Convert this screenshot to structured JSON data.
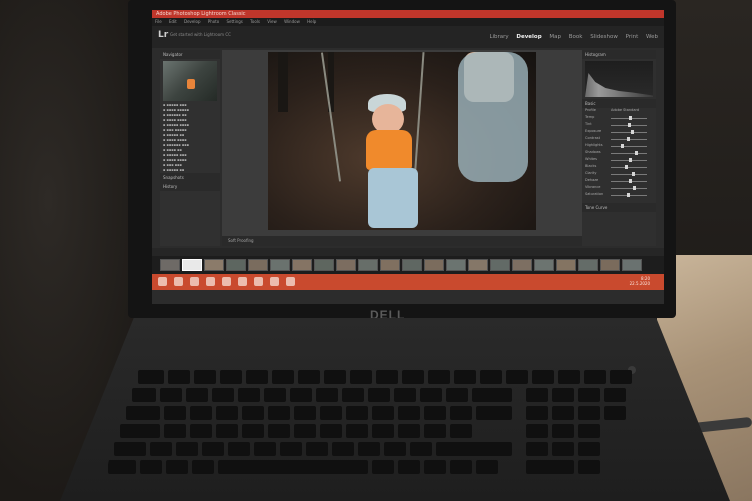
{
  "titlebar": {
    "text": "Adobe Photoshop Lightroom Classic"
  },
  "menubar": {
    "items": [
      "File",
      "Edit",
      "Develop",
      "Photo",
      "Settings",
      "Tools",
      "View",
      "Window",
      "Help"
    ]
  },
  "lr": {
    "logo": "Lr",
    "subtitle": "Get started with Lightroom CC",
    "modules": [
      "Library",
      "Develop",
      "Map",
      "Book",
      "Slideshow",
      "Print",
      "Web"
    ],
    "active_module": "Develop"
  },
  "left_panel": {
    "navigator_label": "Navigator",
    "snapshots_label": "Snapshots",
    "history_label": "History"
  },
  "right_panel": {
    "histogram_label": "Histogram",
    "basic_label": "Basic",
    "profile_label": "Profile",
    "profile_value": "Adobe Standard",
    "tone_curve_label": "Tone Curve",
    "sliders": [
      "Temp",
      "Tint",
      "Exposure",
      "Contrast",
      "Highlights",
      "Shadows",
      "Whites",
      "Blacks",
      "Clarity",
      "Dehaze",
      "Vibrance",
      "Saturation"
    ]
  },
  "toolbar": {
    "soft_proofing": "Soft Proofing"
  },
  "taskbar": {
    "time": "8:20",
    "date": "22.5.2020"
  },
  "brand": {
    "logo": "DELL"
  },
  "colors": {
    "taskbar": "#c94a2e",
    "titlebar": "#c0362b",
    "lr_bg": "#2c2c2c"
  }
}
